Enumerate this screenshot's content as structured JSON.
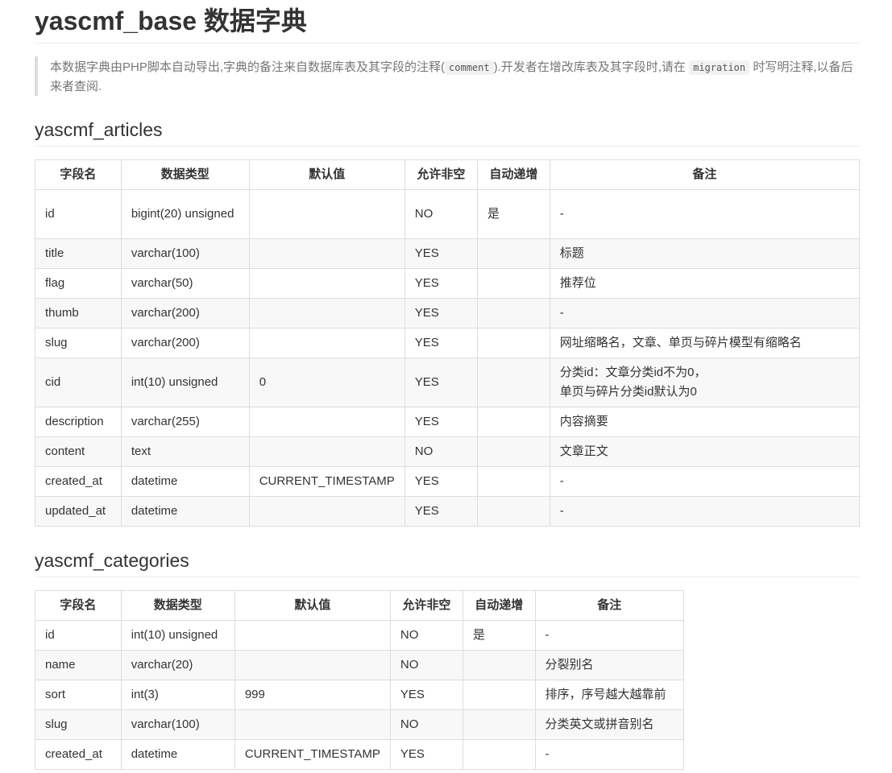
{
  "doc_title": "yascmf_base 数据字典",
  "intro": {
    "part1": "本数据字典由PHP脚本自动导出,字典的备注来自数据库表及其字段的注释(",
    "code1": "comment",
    "part2": ").开发者在增改库表及其字段时,请在",
    "code2": "migration",
    "part3": "时写明注释,以备后来者查阅."
  },
  "columns": [
    "字段名",
    "数据类型",
    "默认值",
    "允许非空",
    "自动递增",
    "备注"
  ],
  "tables": [
    {
      "name": "yascmf_articles",
      "rows": [
        {
          "field": "id",
          "type": "bigint(20) unsigned",
          "default": "",
          "nullable": "NO",
          "auto_increment": "是",
          "comment": "-"
        },
        {
          "field": "title",
          "type": "varchar(100)",
          "default": "",
          "nullable": "YES",
          "auto_increment": "",
          "comment": "标题"
        },
        {
          "field": "flag",
          "type": "varchar(50)",
          "default": "",
          "nullable": "YES",
          "auto_increment": "",
          "comment": "推荐位"
        },
        {
          "field": "thumb",
          "type": "varchar(200)",
          "default": "",
          "nullable": "YES",
          "auto_increment": "",
          "comment": "-"
        },
        {
          "field": "slug",
          "type": "varchar(200)",
          "default": "",
          "nullable": "YES",
          "auto_increment": "",
          "comment": "网址缩略名，文章、单页与碎片模型有缩略名"
        },
        {
          "field": "cid",
          "type": "int(10) unsigned",
          "default": "0",
          "nullable": "YES",
          "auto_increment": "",
          "comment": "分类id：文章分类id不为0，单页与碎片分类id默认为0"
        },
        {
          "field": "description",
          "type": "varchar(255)",
          "default": "",
          "nullable": "YES",
          "auto_increment": "",
          "comment": "内容摘要"
        },
        {
          "field": "content",
          "type": "text",
          "default": "",
          "nullable": "NO",
          "auto_increment": "",
          "comment": "文章正文"
        },
        {
          "field": "created_at",
          "type": "datetime",
          "default": "CURRENT_TIMESTAMP",
          "nullable": "YES",
          "auto_increment": "",
          "comment": "-"
        },
        {
          "field": "updated_at",
          "type": "datetime",
          "default": "",
          "nullable": "YES",
          "auto_increment": "",
          "comment": "-"
        }
      ]
    },
    {
      "name": "yascmf_categories",
      "rows": [
        {
          "field": "id",
          "type": "int(10) unsigned",
          "default": "",
          "nullable": "NO",
          "auto_increment": "是",
          "comment": "-"
        },
        {
          "field": "name",
          "type": "varchar(20)",
          "default": "",
          "nullable": "NO",
          "auto_increment": "",
          "comment": "分裂别名"
        },
        {
          "field": "sort",
          "type": "int(3)",
          "default": "999",
          "nullable": "YES",
          "auto_increment": "",
          "comment": "排序，序号越大越靠前"
        },
        {
          "field": "slug",
          "type": "varchar(100)",
          "default": "",
          "nullable": "NO",
          "auto_increment": "",
          "comment": "分类英文或拼音别名"
        },
        {
          "field": "created_at",
          "type": "datetime",
          "default": "CURRENT_TIMESTAMP",
          "nullable": "YES",
          "auto_increment": "",
          "comment": "-"
        }
      ]
    }
  ]
}
